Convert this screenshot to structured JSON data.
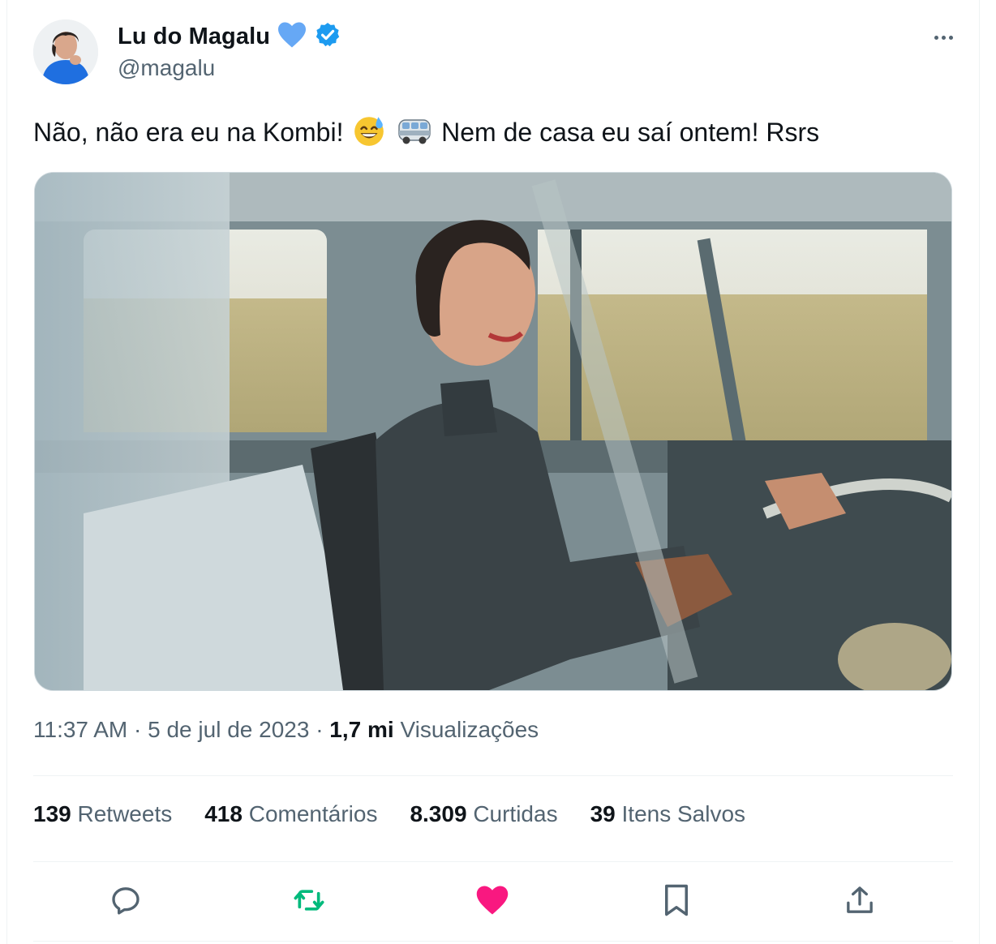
{
  "author": {
    "display_name": "Lu do Magalu",
    "handle": "@magalu",
    "verified": true,
    "heart_badge_color": "#66a8f5",
    "verified_color": "#1d9bf0"
  },
  "tweet": {
    "text_part1": "Não, não era eu na Kombi!",
    "text_part2": "Nem de casa eu saí ontem! Rsrs",
    "emojis": [
      "sweat-smile",
      "minibus"
    ]
  },
  "meta": {
    "time": "11:37 AM",
    "sep1": "·",
    "date": "5 de jul de 2023",
    "sep2": "·",
    "views_count": "1,7 mi",
    "views_label": "Visualizações"
  },
  "stats": {
    "retweets_count": "139",
    "retweets_label": "Retweets",
    "comments_count": "418",
    "comments_label": "Comentários",
    "likes_count": "8.309",
    "likes_label": "Curtidas",
    "saves_count": "39",
    "saves_label": "Itens Salvos"
  },
  "actions": {
    "reply_icon": "reply-icon",
    "retweet_icon": "retweet-icon",
    "like_icon": "heart-icon",
    "bookmark_icon": "bookmark-icon",
    "share_icon": "share-icon",
    "retweet_color": "#00ba7c",
    "like_color": "#f91880",
    "default_color": "#536471"
  }
}
